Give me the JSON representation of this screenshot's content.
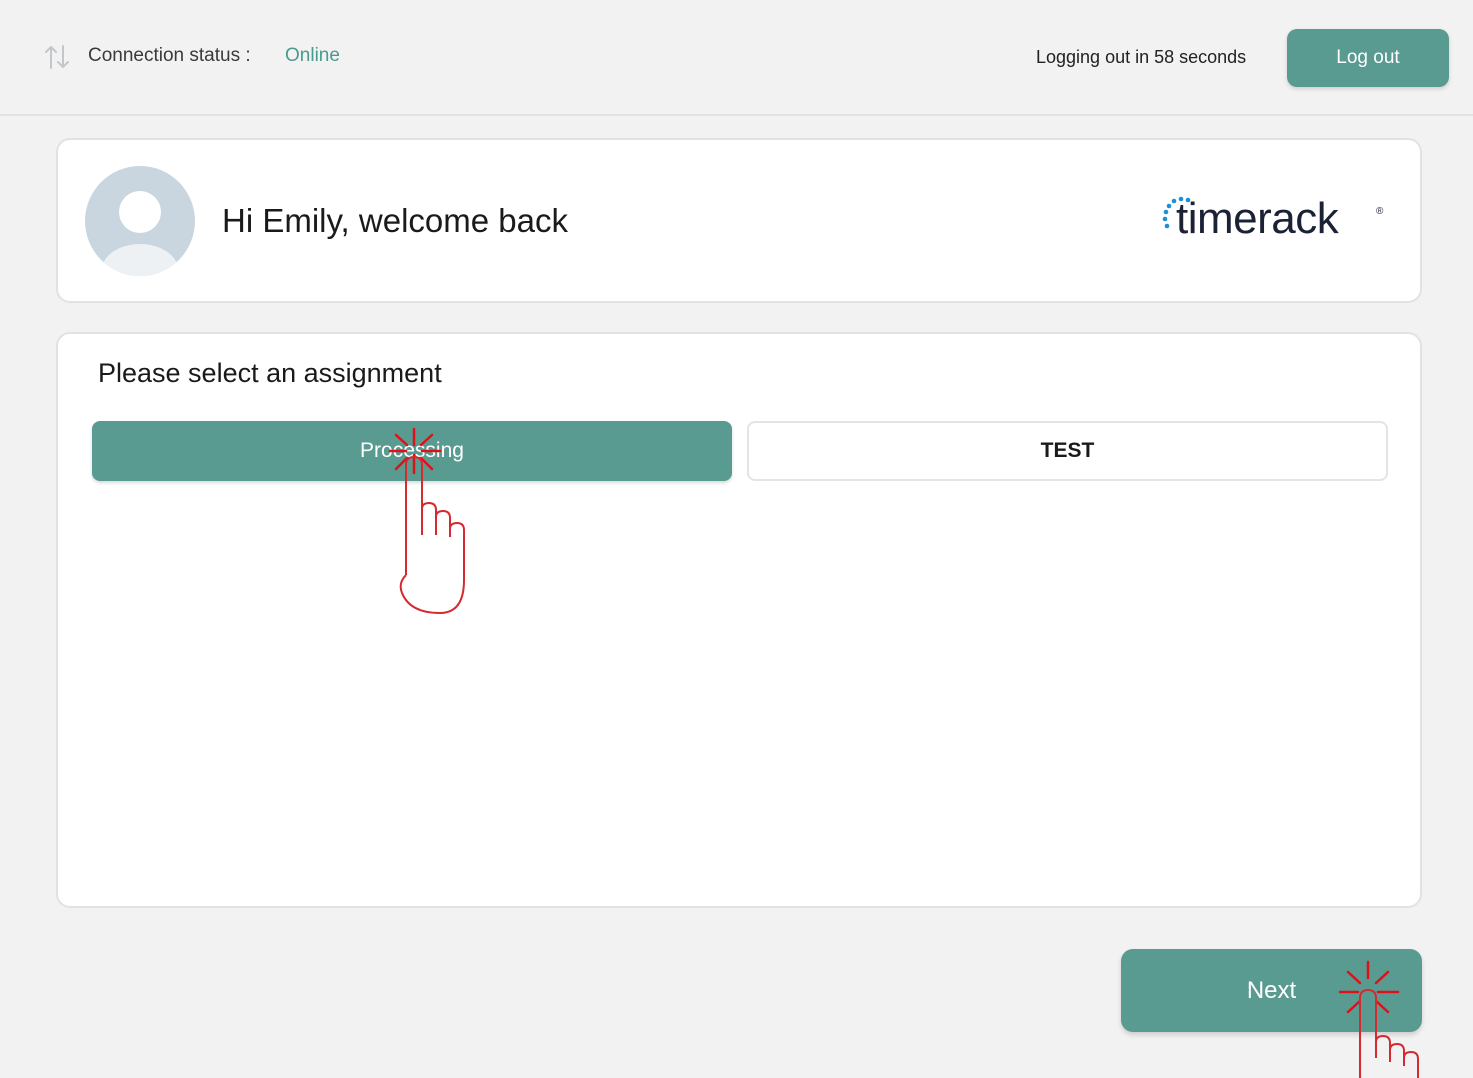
{
  "topbar": {
    "connection_label": "Connection status :",
    "connection_value": "Online",
    "logout_timer": "Logging out in 58 seconds",
    "logout_button": "Log out"
  },
  "welcome": {
    "greeting": "Hi Emily, welcome back",
    "logo_text": "timerack",
    "logo_mark": "®"
  },
  "assignment": {
    "title": "Please select an assignment",
    "options": [
      {
        "label": "Processing",
        "selected": true
      },
      {
        "label": "TEST",
        "selected": false
      }
    ]
  },
  "next_button": "Next",
  "colors": {
    "accent": "#5a9b91",
    "online": "#4a9a90",
    "background": "#f2f2f2",
    "pointer_overlay": "#e0101a"
  },
  "icons": [
    "connection-arrows-icon",
    "user-avatar-icon",
    "tap-hand-icon"
  ]
}
